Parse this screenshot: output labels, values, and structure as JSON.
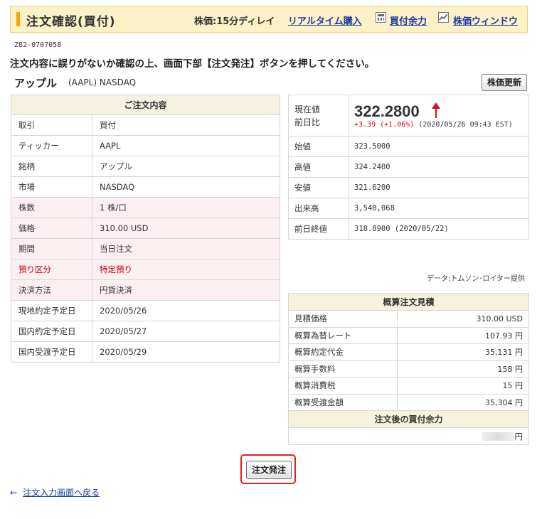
{
  "header": {
    "title": "注文確認(買付)",
    "delay": "株価:15分ディレイ",
    "links": {
      "realtime": "リアルタイム購入",
      "buying_power": "買付余力",
      "price_window": "株価ウィンドウ"
    }
  },
  "order_id": "Z82-0707058",
  "instruction": "注文内容に誤りがないか確認の上、画面下部【注文発注】ボタンを押してください。",
  "stock": {
    "name": "アップル",
    "meta": "(AAPL) NASDAQ"
  },
  "refresh_label": "株価更新",
  "order": {
    "heading": "ご注文内容",
    "rows": [
      {
        "k": "取引",
        "v": "買付"
      },
      {
        "k": "ティッカー",
        "v": "AAPL"
      },
      {
        "k": "銘柄",
        "v": "アップル"
      },
      {
        "k": "市場",
        "v": "NASDAQ"
      },
      {
        "k": "株数",
        "v": "1 株/口"
      },
      {
        "k": "価格",
        "v": "310.00 USD"
      },
      {
        "k": "期間",
        "v": "当日注文"
      },
      {
        "k": "預り区分",
        "v": "特定預り"
      },
      {
        "k": "決済方法",
        "v": "円貨決済"
      },
      {
        "k": "現地約定予定日",
        "v": "2020/05/26"
      },
      {
        "k": "国内約定予定日",
        "v": "2020/05/27"
      },
      {
        "k": "国内受渡予定日",
        "v": "2020/05/29"
      }
    ]
  },
  "quote": {
    "current_label_1": "現在値",
    "current_label_2": "前日比",
    "price": "322.2800",
    "change": "+3.39",
    "change_pct": "(+1.06%)",
    "time": "(2020/05/26 09:43 EST)",
    "rows": [
      {
        "k": "始値",
        "v": "323.5000"
      },
      {
        "k": "高値",
        "v": "324.2400"
      },
      {
        "k": "安値",
        "v": "321.6200"
      },
      {
        "k": "出来高",
        "v": "3,540,068"
      },
      {
        "k": "前日終値",
        "v": "318.8900 (2020/05/22)"
      }
    ],
    "source": "データ:トムソン･ロイター提供"
  },
  "estimate": {
    "heading": "概算注文見積",
    "rows": [
      {
        "k": "見積価格",
        "v": "310.00 USD"
      },
      {
        "k": "概算為替レート",
        "v": "107.93 円"
      },
      {
        "k": "概算約定代金",
        "v": "35,131 円"
      },
      {
        "k": "概算手数料",
        "v": "158 円"
      },
      {
        "k": "概算消費税",
        "v": "15 円"
      },
      {
        "k": "概算受渡金額",
        "v": "35,304 円"
      }
    ],
    "after_heading": "注文後の買付余力",
    "after_unit": "円"
  },
  "submit_label": "注文発注",
  "back": {
    "arrow": "←",
    "label": "注文入力画面へ戻る"
  },
  "colors": {
    "header_bg": "#fdf1c8",
    "accent": "#f0a800",
    "link": "#1a3a9c",
    "alert": "#c00000",
    "highlight_row": "#fbeff2"
  }
}
